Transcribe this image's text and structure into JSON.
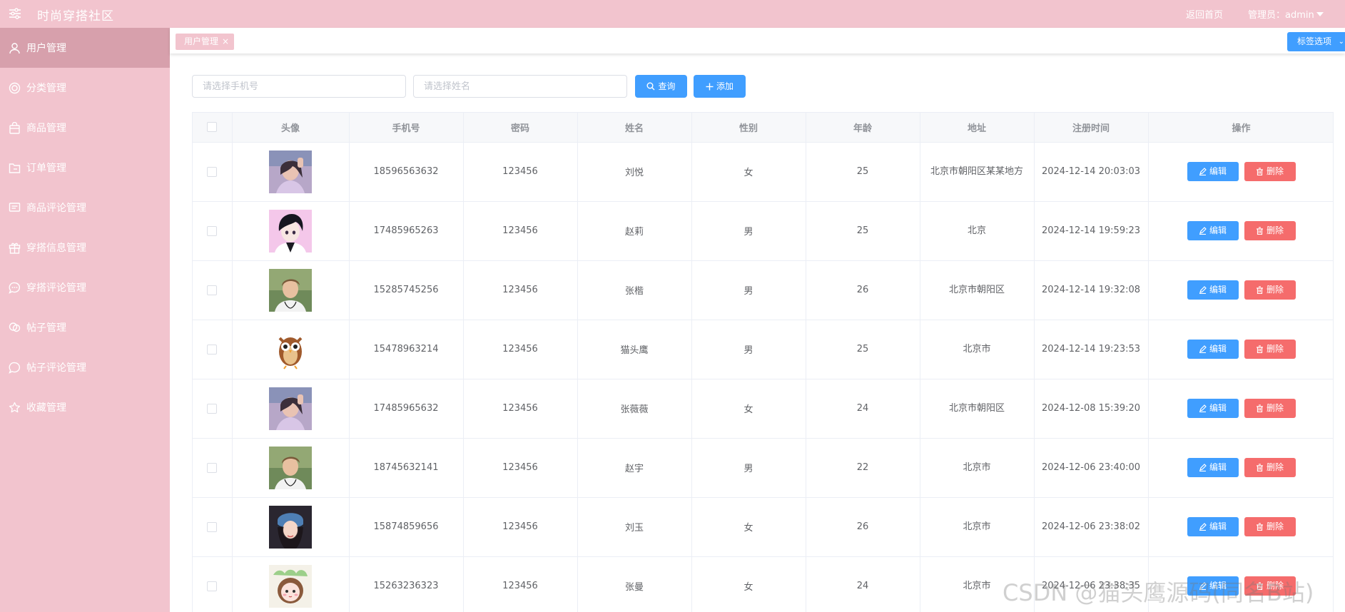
{
  "header": {
    "app_title": "时尚穿搭社区",
    "home_link": "返回首页",
    "admin_label": "管理员：admin",
    "menu_icon": "sliders-icon"
  },
  "sidebar": {
    "items": [
      {
        "label": "用户管理",
        "icon": "user-icon",
        "active": true
      },
      {
        "label": "分类管理",
        "icon": "category-icon",
        "active": false
      },
      {
        "label": "商品管理",
        "icon": "bag-icon",
        "active": false
      },
      {
        "label": "订单管理",
        "icon": "folder-icon",
        "active": false
      },
      {
        "label": "商品评论管理",
        "icon": "comment-icon",
        "active": false
      },
      {
        "label": "穿搭信息管理",
        "icon": "gift-icon",
        "active": false
      },
      {
        "label": "穿搭评论管理",
        "icon": "chat-dots-icon",
        "active": false
      },
      {
        "label": "帖子管理",
        "icon": "post-icon",
        "active": false
      },
      {
        "label": "帖子评论管理",
        "icon": "chat-bubble-icon",
        "active": false
      },
      {
        "label": "收藏管理",
        "icon": "star-icon",
        "active": false
      }
    ]
  },
  "tags": {
    "open": [
      {
        "label": "用户管理",
        "close": "×"
      }
    ],
    "options_label": "标签选项"
  },
  "filters": {
    "phone_placeholder": "请选择手机号",
    "name_placeholder": "请选择姓名",
    "search_label": "查询",
    "add_label": "添加"
  },
  "table": {
    "columns": [
      "头像",
      "手机号",
      "密码",
      "姓名",
      "性别",
      "年龄",
      "地址",
      "注册时间",
      "操作"
    ],
    "edit_label": "编辑",
    "delete_label": "删除",
    "rows": [
      {
        "avatar": "avatar-photo-girl-1",
        "phone": "18596563632",
        "password": "123456",
        "name": "刘悦",
        "gender": "女",
        "age": "25",
        "address": "北京市朝阳区某某地方",
        "registered": "2024-12-14 20:03:03"
      },
      {
        "avatar": "avatar-anime-boy",
        "phone": "17485965263",
        "password": "123456",
        "name": "赵莉",
        "gender": "男",
        "age": "25",
        "address": "北京",
        "registered": "2024-12-14 19:59:23"
      },
      {
        "avatar": "avatar-photo-boy",
        "phone": "15285745256",
        "password": "123456",
        "name": "张楷",
        "gender": "男",
        "age": "26",
        "address": "北京市朝阳区",
        "registered": "2024-12-14 19:32:08"
      },
      {
        "avatar": "avatar-owl",
        "phone": "15478963214",
        "password": "123456",
        "name": "猫头鹰",
        "gender": "男",
        "age": "25",
        "address": "北京市",
        "registered": "2024-12-14 19:23:53"
      },
      {
        "avatar": "avatar-photo-girl-1",
        "phone": "17485965632",
        "password": "123456",
        "name": "张薇薇",
        "gender": "女",
        "age": "24",
        "address": "北京市朝阳区",
        "registered": "2024-12-08 15:39:20"
      },
      {
        "avatar": "avatar-photo-boy",
        "phone": "18745632141",
        "password": "123456",
        "name": "赵宇",
        "gender": "男",
        "age": "22",
        "address": "北京市",
        "registered": "2024-12-06 23:40:00"
      },
      {
        "avatar": "avatar-photo-girl-2",
        "phone": "15874859656",
        "password": "123456",
        "name": "刘玉",
        "gender": "女",
        "age": "26",
        "address": "北京市",
        "registered": "2024-12-06 23:38:02"
      },
      {
        "avatar": "avatar-cartoon-girl",
        "phone": "15263236323",
        "password": "123456",
        "name": "张曼",
        "gender": "女",
        "age": "24",
        "address": "北京市",
        "registered": "2024-12-06 23:38:35"
      }
    ]
  },
  "watermark": "CSDN @猫头鹰源码(同名B站)",
  "colors": {
    "theme_pink": "#f2c4ce",
    "active_pink": "#d7a0ac",
    "primary_blue": "#409eff",
    "danger_red": "#f56c6c"
  }
}
